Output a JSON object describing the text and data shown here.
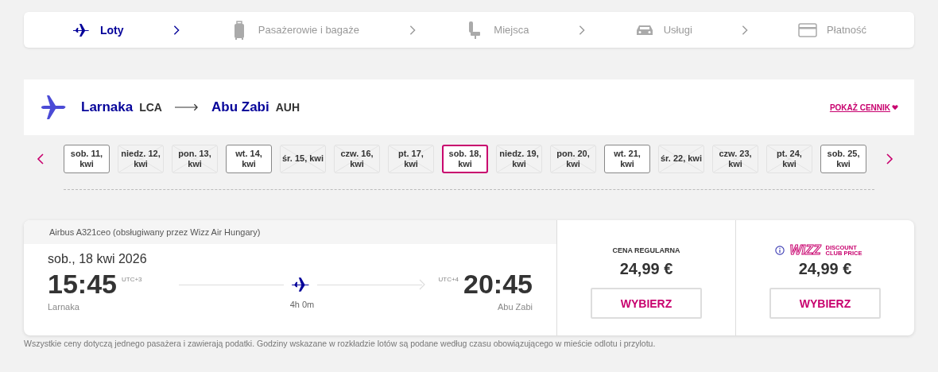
{
  "steps": [
    {
      "label": "Loty",
      "kind": "flights",
      "selected": true
    },
    {
      "label": "Pasażerowie i bagaże",
      "kind": "passengers",
      "selected": false
    },
    {
      "label": "Miejsca",
      "kind": "seats",
      "selected": false
    },
    {
      "label": "Usługi",
      "kind": "services",
      "selected": false
    },
    {
      "label": "Płatność",
      "kind": "payment",
      "selected": false
    }
  ],
  "route": {
    "origin": "Larnaka",
    "origin_code": "LCA",
    "destination": "Abu Zabi",
    "destination_code": "AUH",
    "price_link": "POKAŻ CENNIK"
  },
  "dates": [
    {
      "label": "sob. 11, kwi",
      "available": true,
      "selected": false
    },
    {
      "label": "niedz. 12, kwi",
      "available": false,
      "selected": false
    },
    {
      "label": "pon. 13, kwi",
      "available": false,
      "selected": false
    },
    {
      "label": "wt. 14, kwi",
      "available": true,
      "selected": false
    },
    {
      "label": "śr. 15, kwi",
      "available": false,
      "selected": false
    },
    {
      "label": "czw. 16, kwi",
      "available": false,
      "selected": false
    },
    {
      "label": "pt. 17, kwi",
      "available": false,
      "selected": false
    },
    {
      "label": "sob. 18, kwi",
      "available": true,
      "selected": true
    },
    {
      "label": "niedz. 19, kwi",
      "available": false,
      "selected": false
    },
    {
      "label": "pon. 20, kwi",
      "available": false,
      "selected": false
    },
    {
      "label": "wt. 21, kwi",
      "available": true,
      "selected": false
    },
    {
      "label": "śr. 22, kwi",
      "available": false,
      "selected": false
    },
    {
      "label": "czw. 23, kwi",
      "available": false,
      "selected": false
    },
    {
      "label": "pt. 24, kwi",
      "available": false,
      "selected": false
    },
    {
      "label": "sob. 25, kwi",
      "available": true,
      "selected": false
    }
  ],
  "flight": {
    "aircraft": "Airbus A321ceo (obsługiwany przez Wizz Air Hungary)",
    "date": "sob., 18 kwi 2026",
    "departure_time": "15:45",
    "departure_tz": "UTC+3",
    "departure_city": "Larnaka",
    "arrival_tz": "UTC+4",
    "arrival_time": "20:45",
    "arrival_city": "Abu Zabi",
    "duration": "4h 0m"
  },
  "fares": [
    {
      "kind": "regular",
      "title": "CENA REGULARNA",
      "price": "24,99 €",
      "button": "WYBIERZ"
    },
    {
      "kind": "club",
      "logo": "WIZZ",
      "title": "DISCOUNT CLUB PRICE",
      "price": "24,99 €",
      "button": "WYBIERZ"
    }
  ],
  "footnote": "Wszystkie ceny dotyczą jednego pasażera i zawierają podatki. Godziny wskazane w rozkładzie lotów są podane według czasu obowiązującego w mieście odlotu i przylotu."
}
